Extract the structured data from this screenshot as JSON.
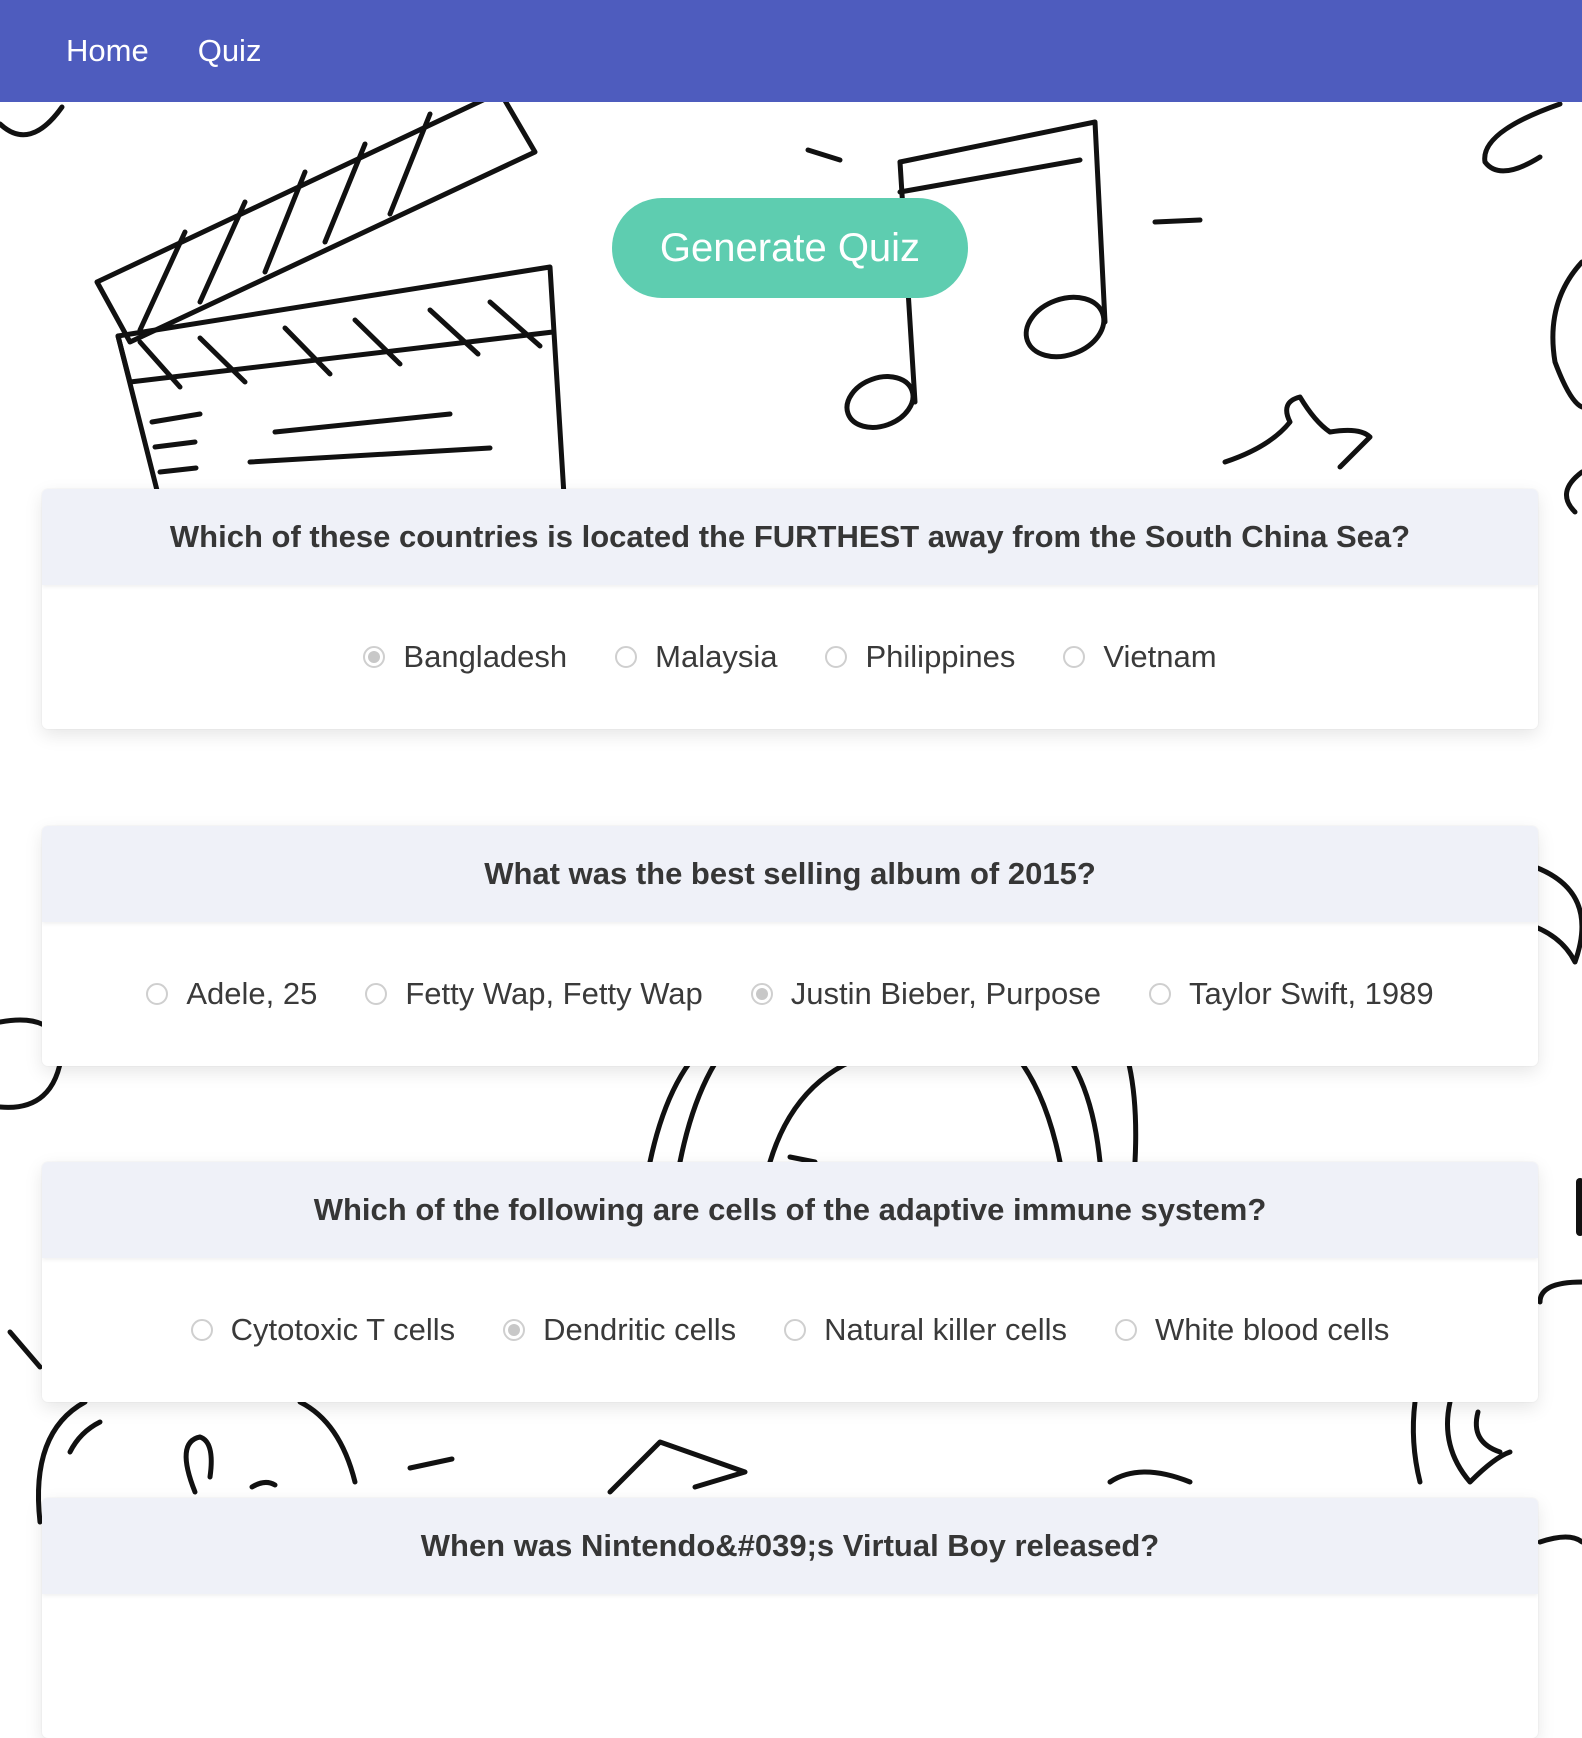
{
  "nav": {
    "home": "Home",
    "quiz": "Quiz"
  },
  "generate_button": "Generate Quiz",
  "colors": {
    "navbar": "#4e5cbe",
    "button": "#5ecdb0",
    "card_header": "#eff1f8"
  },
  "questions": [
    {
      "text": "Which of these countries is located the FURTHEST away from the South China Sea?",
      "options": [
        "Bangladesh",
        "Malaysia",
        "Philippines",
        "Vietnam"
      ],
      "selected": "Bangladesh"
    },
    {
      "text": "What was the best selling album of 2015?",
      "options": [
        "Adele, 25",
        "Fetty Wap, Fetty Wap",
        "Justin Bieber, Purpose",
        "Taylor Swift, 1989"
      ],
      "selected": "Justin Bieber, Purpose"
    },
    {
      "text": "Which of the following are cells of the adaptive immune system?",
      "options": [
        "Cytotoxic T cells",
        "Dendritic cells",
        "Natural killer cells",
        "White blood cells"
      ],
      "selected": "Dendritic cells"
    },
    {
      "text": "When was Nintendo&#039;s Virtual Boy released?",
      "options": [],
      "selected": ""
    }
  ]
}
